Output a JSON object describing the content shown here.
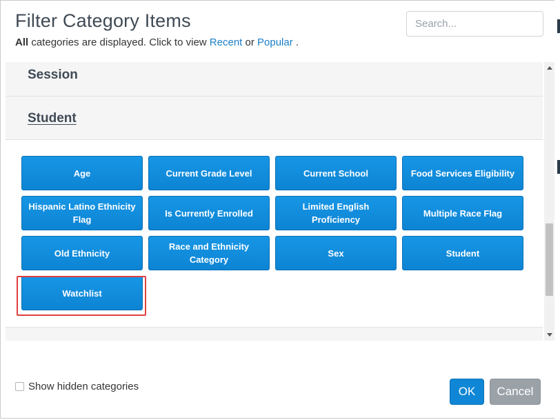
{
  "dialog": {
    "title": "Filter Category Items",
    "subtitle_prefix_bold": "All",
    "subtitle_text": " categories are displayed. Click to view ",
    "link_recent": "Recent",
    "subtitle_or": " or ",
    "link_popular": "Popular",
    "subtitle_end": " ."
  },
  "search": {
    "placeholder": "Search...",
    "value": ""
  },
  "categories": [
    {
      "label": "Session",
      "active": false
    },
    {
      "label": "Student",
      "active": true
    }
  ],
  "items": [
    "Age",
    "Current Grade Level",
    "Current School",
    "Food Services Eligibility",
    "Hispanic Latino Ethnicity Flag",
    "Is Currently Enrolled",
    "Limited English Proficiency",
    "Multiple Race Flag",
    "Old Ethnicity",
    "Race and Ethnicity Category",
    "Sex",
    "Student",
    "Watchlist"
  ],
  "highlighted_item": "Watchlist",
  "footer": {
    "show_hidden_label": "Show hidden categories",
    "show_hidden_checked": false,
    "ok_label": "OK",
    "cancel_label": "Cancel"
  },
  "colors": {
    "button_blue": "#1796e6",
    "link_blue": "#1a7fc6",
    "highlight_red": "#e04040",
    "cancel_gray": "#9aa2a8"
  }
}
